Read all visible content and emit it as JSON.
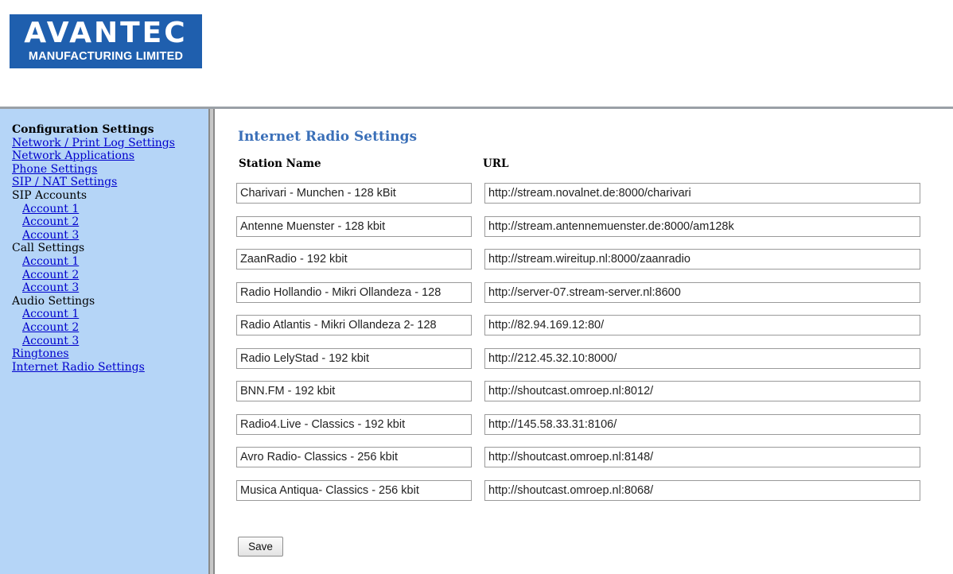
{
  "logo": {
    "mark": "AVANTEC",
    "subtitle": "MANUFACTURING LIMITED"
  },
  "sidebar": {
    "heading": "Configuration Settings",
    "links": {
      "network_print_log": "Network / Print Log Settings",
      "network_applications": "Network Applications",
      "phone_settings": "Phone Settings",
      "sip_nat_settings": "SIP / NAT Settings"
    },
    "sip_accounts": {
      "label": "SIP Accounts",
      "items": [
        "Account 1",
        "Account 2",
        "Account 3"
      ]
    },
    "call_settings": {
      "label": "Call Settings",
      "items": [
        "Account 1",
        "Account 2",
        "Account 3"
      ]
    },
    "audio_settings": {
      "label": "Audio Settings",
      "items": [
        "Account 1",
        "Account 2",
        "Account 3"
      ]
    },
    "ringtones": "Ringtones",
    "internet_radio": "Internet Radio Settings"
  },
  "main": {
    "title": "Internet Radio Settings",
    "col_station": "Station Name",
    "col_url": "URL",
    "stations": [
      {
        "name": "Charivari - Munchen - 128 kBit",
        "url": "http://stream.novalnet.de:8000/charivari"
      },
      {
        "name": "Antenne Muenster - 128 kbit",
        "url": "http://stream.antennemuenster.de:8000/am128k"
      },
      {
        "name": "ZaanRadio - 192 kbit",
        "url": "http://stream.wireitup.nl:8000/zaanradio"
      },
      {
        "name": "Radio Hollandio - Mikri Ollandeza - 128",
        "url": "http://server-07.stream-server.nl:8600"
      },
      {
        "name": "Radio Atlantis - Mikri Ollandeza 2- 128",
        "url": "http://82.94.169.12:80/"
      },
      {
        "name": "Radio LelyStad - 192 kbit",
        "url": "http://212.45.32.10:8000/"
      },
      {
        "name": "BNN.FM - 192 kbit",
        "url": "http://shoutcast.omroep.nl:8012/"
      },
      {
        "name": "Radio4.Live - Classics - 192 kbit",
        "url": "http://145.58.33.31:8106/"
      },
      {
        "name": "Avro Radio- Classics - 256 kbit",
        "url": "http://shoutcast.omroep.nl:8148/"
      },
      {
        "name": "Musica Antiqua- Classics - 256 kbit",
        "url": "http://shoutcast.omroep.nl:8068/"
      }
    ],
    "save_label": "Save"
  },
  "colors": {
    "logo_bg": "#1f5fae",
    "sidebar_bg": "#b5d5f7",
    "title": "#3a6fb8",
    "link": "#0000cc"
  }
}
